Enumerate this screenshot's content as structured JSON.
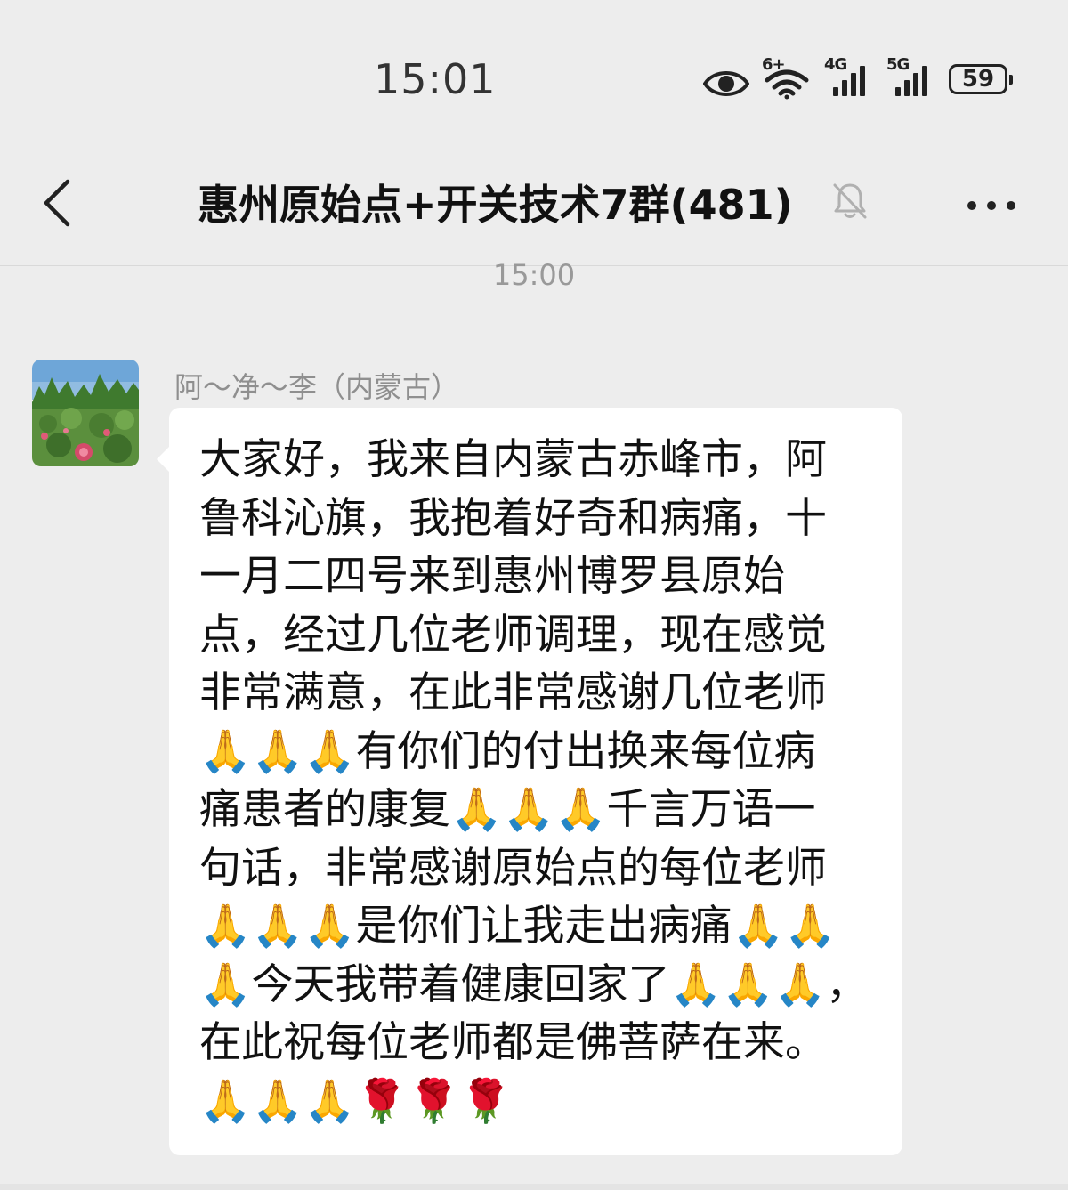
{
  "status_bar": {
    "time": "15:01",
    "wifi_label": "6+",
    "network_1": "4G",
    "network_2": "5G",
    "battery": "59",
    "icons": [
      "eye-icon",
      "wifi-icon",
      "signal-4g-icon",
      "signal-5g-icon",
      "battery-icon"
    ]
  },
  "header": {
    "title": "惠州原始点+开关技术7群(481)",
    "back_icon": "chevron-left-icon",
    "mute_icon": "bell-off-icon",
    "more_icon": "more-dots-icon"
  },
  "chat": {
    "timestamp": "15:00",
    "messages": [
      {
        "sender": "阿～净～李（内蒙古）",
        "avatar": "avatar-lotus-field",
        "text": "大家好，我来自内蒙古赤峰市，阿\n鲁科沁旗，我抱着好奇和病痛，十\n一月二四号来到惠州博罗县原始\n点，经过几位老师调理，现在感觉\n非常满意，在此非常感谢几位老师\n🙏🙏🙏有你们的付出换来每位病\n痛患者的康复🙏🙏🙏千言万语一\n句话，非常感谢原始点的每位老师\n🙏🙏🙏是你们让我走出病痛🙏🙏\n🙏今天我带着健康回家了🙏🙏🙏，\n在此祝每位老师都是佛菩萨在来。\n🙏🙏🙏🌹🌹🌹"
      }
    ]
  },
  "colors": {
    "background": "#ededed",
    "bubble": "#ffffff",
    "text": "#111111",
    "muted": "#999999"
  }
}
